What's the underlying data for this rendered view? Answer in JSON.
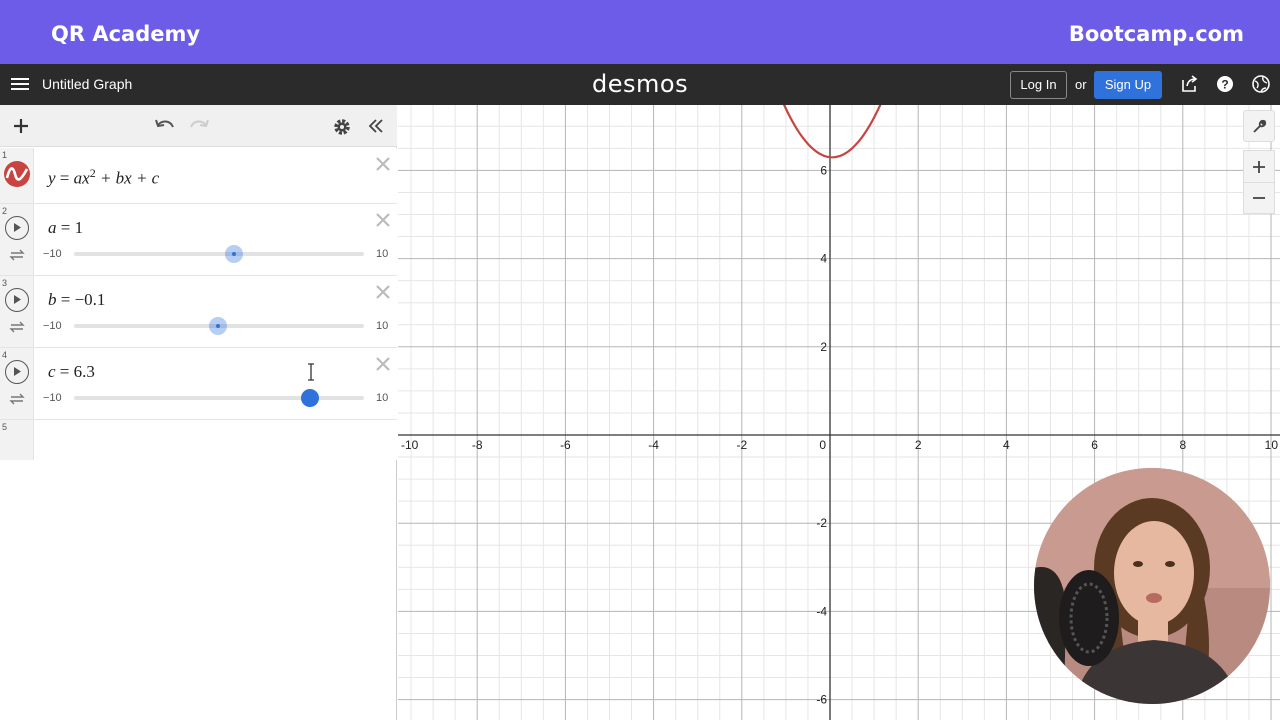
{
  "banner": {
    "left": "QR Academy",
    "right": "Bootcamp.com",
    "color": "#6c5ce7"
  },
  "topbar": {
    "title": "Untitled Graph",
    "logo": "desmos",
    "login": "Log In",
    "or": "or",
    "signup": "Sign Up"
  },
  "expressions": [
    {
      "index": "1",
      "type": "expression",
      "latex_parts": {
        "y": "y",
        "eq": "=",
        "a": "ax",
        "exp": "2",
        "rest": "+ bx + c"
      }
    },
    {
      "index": "2",
      "type": "slider",
      "name": "a",
      "eq": "=",
      "value": "1",
      "min": "−10",
      "max": "10",
      "fraction": 0.55
    },
    {
      "index": "3",
      "type": "slider",
      "name": "b",
      "eq": "=",
      "value": "−0.1",
      "min": "−10",
      "max": "10",
      "fraction": 0.495
    },
    {
      "index": "4",
      "type": "slider",
      "name": "c",
      "eq": "=",
      "value": "6.3",
      "min": "−10",
      "max": "10",
      "fraction": 0.815
    },
    {
      "index": "5",
      "type": "empty"
    }
  ],
  "graph": {
    "x_ticks": [
      "-10",
      "-8",
      "-6",
      "-4",
      "-2",
      "0",
      "2",
      "4",
      "6",
      "8",
      "10"
    ],
    "y_ticks": [
      "6",
      "4",
      "2",
      "-2",
      "-4",
      "-6"
    ],
    "curve_color": "#c74440",
    "accent": "#2f72dc"
  }
}
